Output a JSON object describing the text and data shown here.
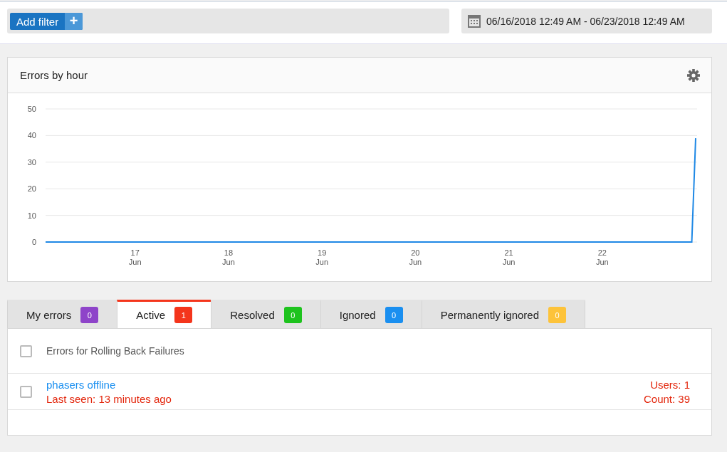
{
  "filter_bar": {
    "add_filter_label": "Add filter",
    "add_icon": "+"
  },
  "date_range": {
    "text": "06/16/2018 12:49 AM - 06/23/2018 12:49 AM"
  },
  "chart_panel": {
    "title": "Errors by hour",
    "chart_data": {
      "type": "line",
      "grid": true,
      "ylim": [
        0,
        50
      ],
      "yticks": [
        0,
        10,
        20,
        30,
        40,
        50
      ],
      "categories": [
        null,
        null,
        null,
        null,
        null,
        null,
        null,
        null,
        null,
        null,
        null,
        null,
        null,
        null,
        null,
        null,
        null,
        null,
        null,
        null,
        null,
        null,
        null,
        "17 Jun",
        null,
        null,
        null,
        null,
        null,
        null,
        null,
        null,
        null,
        null,
        null,
        null,
        null,
        null,
        null,
        null,
        null,
        null,
        null,
        null,
        null,
        null,
        null,
        "18 Jun",
        null,
        null,
        null,
        null,
        null,
        null,
        null,
        null,
        null,
        null,
        null,
        null,
        null,
        null,
        null,
        null,
        null,
        null,
        null,
        null,
        null,
        null,
        null,
        "19 Jun",
        null,
        null,
        null,
        null,
        null,
        null,
        null,
        null,
        null,
        null,
        null,
        null,
        null,
        null,
        null,
        null,
        null,
        null,
        null,
        null,
        null,
        null,
        null,
        "20 Jun",
        null,
        null,
        null,
        null,
        null,
        null,
        null,
        null,
        null,
        null,
        null,
        null,
        null,
        null,
        null,
        null,
        null,
        null,
        null,
        null,
        null,
        null,
        null,
        "21 Jun",
        null,
        null,
        null,
        null,
        null,
        null,
        null,
        null,
        null,
        null,
        null,
        null,
        null,
        null,
        null,
        null,
        null,
        null,
        null,
        null,
        null,
        null,
        null,
        "22 Jun",
        null,
        null,
        null,
        null,
        null,
        null,
        null,
        null,
        null,
        null,
        null,
        null,
        null,
        null,
        null,
        null,
        null,
        null,
        null,
        null,
        null,
        null,
        null,
        null
      ],
      "series": [
        {
          "color": "#1e88e5",
          "values": [
            0,
            0,
            0,
            0,
            0,
            0,
            0,
            0,
            0,
            0,
            0,
            0,
            0,
            0,
            0,
            0,
            0,
            0,
            0,
            0,
            0,
            0,
            0,
            0,
            0,
            0,
            0,
            0,
            0,
            0,
            0,
            0,
            0,
            0,
            0,
            0,
            0,
            0,
            0,
            0,
            0,
            0,
            0,
            0,
            0,
            0,
            0,
            0,
            0,
            0,
            0,
            0,
            0,
            0,
            0,
            0,
            0,
            0,
            0,
            0,
            0,
            0,
            0,
            0,
            0,
            0,
            0,
            0,
            0,
            0,
            0,
            0,
            0,
            0,
            0,
            0,
            0,
            0,
            0,
            0,
            0,
            0,
            0,
            0,
            0,
            0,
            0,
            0,
            0,
            0,
            0,
            0,
            0,
            0,
            0,
            0,
            0,
            0,
            0,
            0,
            0,
            0,
            0,
            0,
            0,
            0,
            0,
            0,
            0,
            0,
            0,
            0,
            0,
            0,
            0,
            0,
            0,
            0,
            0,
            0,
            0,
            0,
            0,
            0,
            0,
            0,
            0,
            0,
            0,
            0,
            0,
            0,
            0,
            0,
            0,
            0,
            0,
            0,
            0,
            0,
            0,
            0,
            0,
            0,
            0,
            0,
            0,
            0,
            0,
            0,
            0,
            0,
            0,
            0,
            0,
            0,
            0,
            0,
            0,
            0,
            0,
            0,
            0,
            0,
            0,
            0,
            0,
            39
          ]
        }
      ]
    }
  },
  "tabs": [
    {
      "label": "My errors",
      "count": "0",
      "color": "#8e44c9",
      "selected": false
    },
    {
      "label": "Active",
      "count": "1",
      "color": "#f4351c",
      "selected": true
    },
    {
      "label": "Resolved",
      "count": "0",
      "color": "#1ec31e",
      "selected": false
    },
    {
      "label": "Ignored",
      "count": "0",
      "color": "#1a8ff0",
      "selected": false
    },
    {
      "label": "Permanently ignored",
      "count": "0",
      "color": "#fdc33a",
      "selected": false
    }
  ],
  "error_list": {
    "header": {
      "title": "Errors for Rolling Back Failures",
      "checked": false
    },
    "items": [
      {
        "title": "phasers offline",
        "last_seen": "Last seen: 13 minutes ago",
        "users": "Users: 1",
        "count": "Count: 39",
        "checked": false
      }
    ]
  }
}
